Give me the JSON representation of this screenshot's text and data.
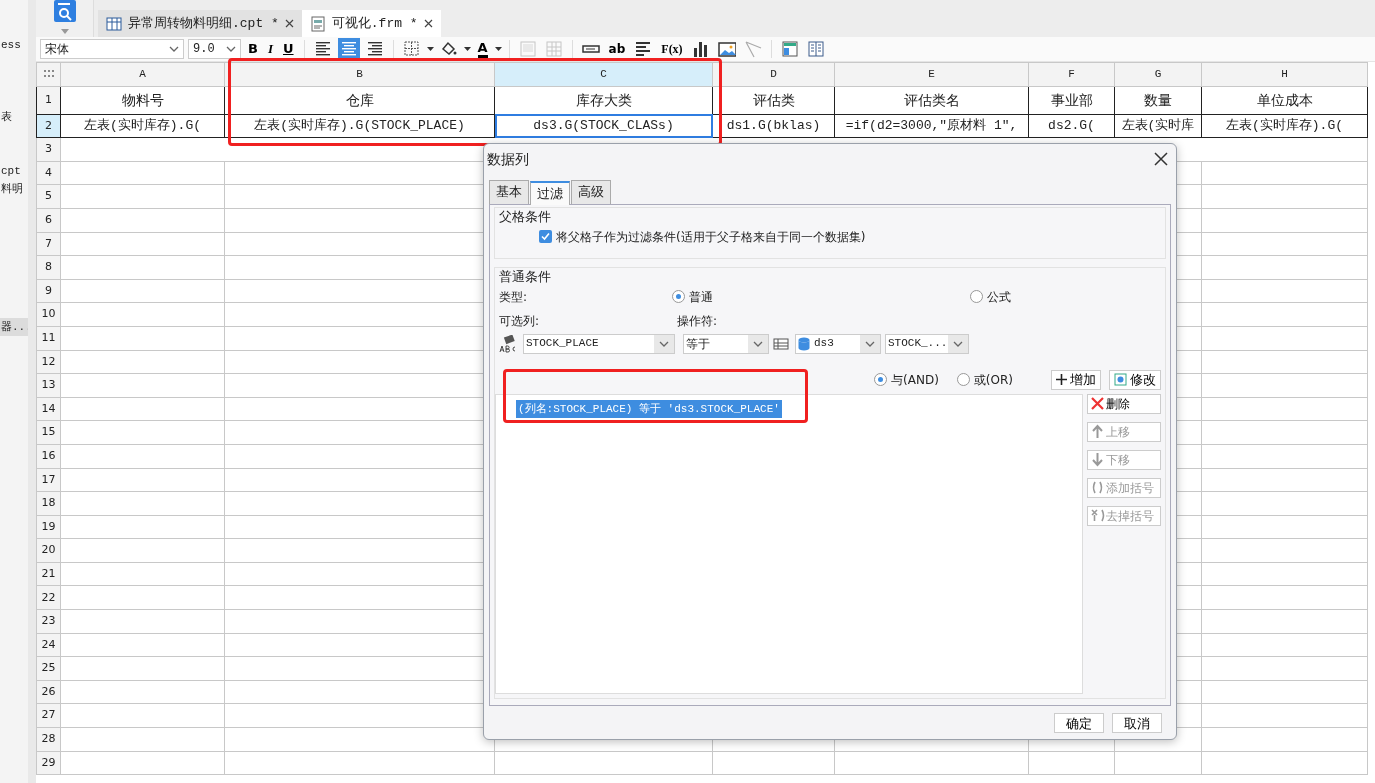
{
  "sidebar": {
    "items": [
      {
        "text": "ess",
        "selected": false
      },
      {
        "text": "表",
        "selected": false
      },
      {
        "text": "cpt",
        "selected": false
      },
      {
        "text": "料明",
        "selected": false
      },
      {
        "text": "器...",
        "selected": true
      }
    ]
  },
  "file_tabs": [
    {
      "label": "异常周转物料明细.cpt *",
      "selected": false,
      "kind": "report"
    },
    {
      "label": "可视化.frm *",
      "selected": true,
      "kind": "form"
    }
  ],
  "format_toolbar": {
    "font": "宋体",
    "size": "9.0",
    "tools": [
      {
        "kind": "bold",
        "label": "B",
        "selected": false
      },
      {
        "kind": "italic",
        "label": "I",
        "selected": false
      },
      {
        "kind": "underline",
        "label": "U",
        "selected": false
      },
      {
        "kind": "sep"
      },
      {
        "kind": "align-left",
        "selected": false
      },
      {
        "kind": "align-center",
        "selected": true
      },
      {
        "kind": "align-right",
        "selected": false
      },
      {
        "kind": "sep"
      },
      {
        "kind": "border",
        "selected": false
      },
      {
        "kind": "fill",
        "selected": false
      },
      {
        "kind": "color",
        "label": "A",
        "selected": false
      },
      {
        "kind": "sep"
      },
      {
        "kind": "merge",
        "disabled": true
      },
      {
        "kind": "unmerge",
        "disabled": true
      },
      {
        "kind": "sep"
      },
      {
        "kind": "field",
        "selected": false
      },
      {
        "kind": "textlabel",
        "label": "ab",
        "selected": false
      },
      {
        "kind": "lines",
        "selected": false
      },
      {
        "kind": "formula",
        "label": "F(x)",
        "selected": false
      },
      {
        "kind": "chart",
        "selected": false
      },
      {
        "kind": "image",
        "selected": false
      },
      {
        "kind": "slash",
        "selected": false
      },
      {
        "kind": "sep"
      },
      {
        "kind": "layout",
        "selected": false
      },
      {
        "kind": "columns",
        "selected": false
      }
    ]
  },
  "sheet": {
    "columns": [
      {
        "label": "A",
        "selected": false
      },
      {
        "label": "B",
        "selected": false
      },
      {
        "label": "C",
        "selected": true
      },
      {
        "label": "D",
        "selected": false
      },
      {
        "label": "E",
        "selected": false
      },
      {
        "label": "F",
        "selected": false
      },
      {
        "label": "G",
        "selected": false
      },
      {
        "label": "H",
        "selected": false
      }
    ],
    "rows": [
      {
        "number": "1",
        "selected": false,
        "merged": false,
        "cells": [
          {
            "text": "物料号",
            "selected": false
          },
          {
            "text": "仓库",
            "selected": false
          },
          {
            "text": "库存大类",
            "selected": false
          },
          {
            "text": "评估类",
            "selected": false
          },
          {
            "text": "评估类名",
            "selected": false
          },
          {
            "text": "事业部",
            "selected": false
          },
          {
            "text": "数量",
            "selected": false
          },
          {
            "text": "单位成本",
            "selected": false
          }
        ]
      },
      {
        "number": "2",
        "selected": true,
        "merged": false,
        "cells": [
          {
            "text": "左表(实时库存).G(",
            "selected": false
          },
          {
            "text": "左表(实时库存).G(STOCK_PLACE)",
            "selected": false
          },
          {
            "text": "ds3.G(STOCK_CLASs)",
            "selected": true
          },
          {
            "text": "ds1.G(bklas)",
            "selected": false
          },
          {
            "text": "=if(d2=3000,\"原材料 1\",",
            "selected": false
          },
          {
            "text": "ds2.G(",
            "selected": false
          },
          {
            "text": "左表(实时库",
            "selected": false
          },
          {
            "text": "左表(实时库存).G(",
            "selected": false
          }
        ]
      },
      {
        "number": "3",
        "selected": false,
        "merged": true
      },
      {
        "number": "4",
        "selected": false,
        "merged": false
      },
      {
        "number": "5",
        "selected": false,
        "merged": false
      },
      {
        "number": "6",
        "selected": false,
        "merged": false
      },
      {
        "number": "7",
        "selected": false,
        "merged": false
      },
      {
        "number": "8",
        "selected": false,
        "merged": false
      },
      {
        "number": "9",
        "selected": false,
        "merged": false
      },
      {
        "number": "10",
        "selected": false,
        "merged": false
      },
      {
        "number": "11",
        "selected": false,
        "merged": false
      },
      {
        "number": "12",
        "selected": false,
        "merged": false
      },
      {
        "number": "13",
        "selected": false,
        "merged": false
      },
      {
        "number": "14",
        "selected": false,
        "merged": false
      },
      {
        "number": "15",
        "selected": false,
        "merged": false
      },
      {
        "number": "16",
        "selected": false,
        "merged": false
      },
      {
        "number": "17",
        "selected": false,
        "merged": false
      },
      {
        "number": "18",
        "selected": false,
        "merged": false
      },
      {
        "number": "19",
        "selected": false,
        "merged": false
      },
      {
        "number": "20",
        "selected": false,
        "merged": false
      },
      {
        "number": "21",
        "selected": false,
        "merged": false
      },
      {
        "number": "22",
        "selected": false,
        "merged": false
      },
      {
        "number": "23",
        "selected": false,
        "merged": false
      },
      {
        "number": "24",
        "selected": false,
        "merged": false
      },
      {
        "number": "25",
        "selected": false,
        "merged": false
      },
      {
        "number": "26",
        "selected": false,
        "merged": false
      },
      {
        "number": "27",
        "selected": false,
        "merged": false
      },
      {
        "number": "28",
        "selected": false,
        "merged": false
      },
      {
        "number": "29",
        "selected": false,
        "merged": false
      }
    ]
  },
  "dialog": {
    "title": "数据列",
    "tabs": [
      {
        "label": "基本",
        "selected": false
      },
      {
        "label": "过滤",
        "selected": true
      },
      {
        "label": "高级",
        "selected": false
      }
    ],
    "parent_group": {
      "legend": "父格条件",
      "checkbox": {
        "label": "将父格子作为过滤条件(适用于父子格来自于同一个数据集)",
        "checked": true
      }
    },
    "normal_group": {
      "legend": "普通条件",
      "type_label": "类型:",
      "type_options": [
        {
          "label": "普通",
          "selected": true
        },
        {
          "label": "公式",
          "selected": false
        }
      ],
      "column_label": "可选列:",
      "operator_label": "操作符:",
      "column_select": "STOCK_PLACE",
      "operator_select": "等于",
      "dataset_select": "ds3",
      "field_select": "STOCK_...",
      "join_options": [
        {
          "label": "与(AND)",
          "selected": true
        },
        {
          "label": "或(OR)",
          "selected": false
        }
      ],
      "add_button": "增加",
      "modify_button": "修改",
      "conditions": [
        {
          "text": "(列名:STOCK_PLACE) 等于 'ds3.STOCK_PLACE'",
          "selected": true
        }
      ],
      "side_buttons": [
        {
          "kind": "delete",
          "label": "删除",
          "disabled": false
        },
        {
          "kind": "up",
          "label": "上移",
          "disabled": true
        },
        {
          "kind": "down",
          "label": "下移",
          "disabled": true
        },
        {
          "kind": "add-paren",
          "label": "添加括号",
          "disabled": true
        },
        {
          "kind": "remove-paren",
          "label": "去掉括号",
          "disabled": true
        }
      ]
    },
    "buttons": [
      "确定",
      "取消"
    ]
  }
}
